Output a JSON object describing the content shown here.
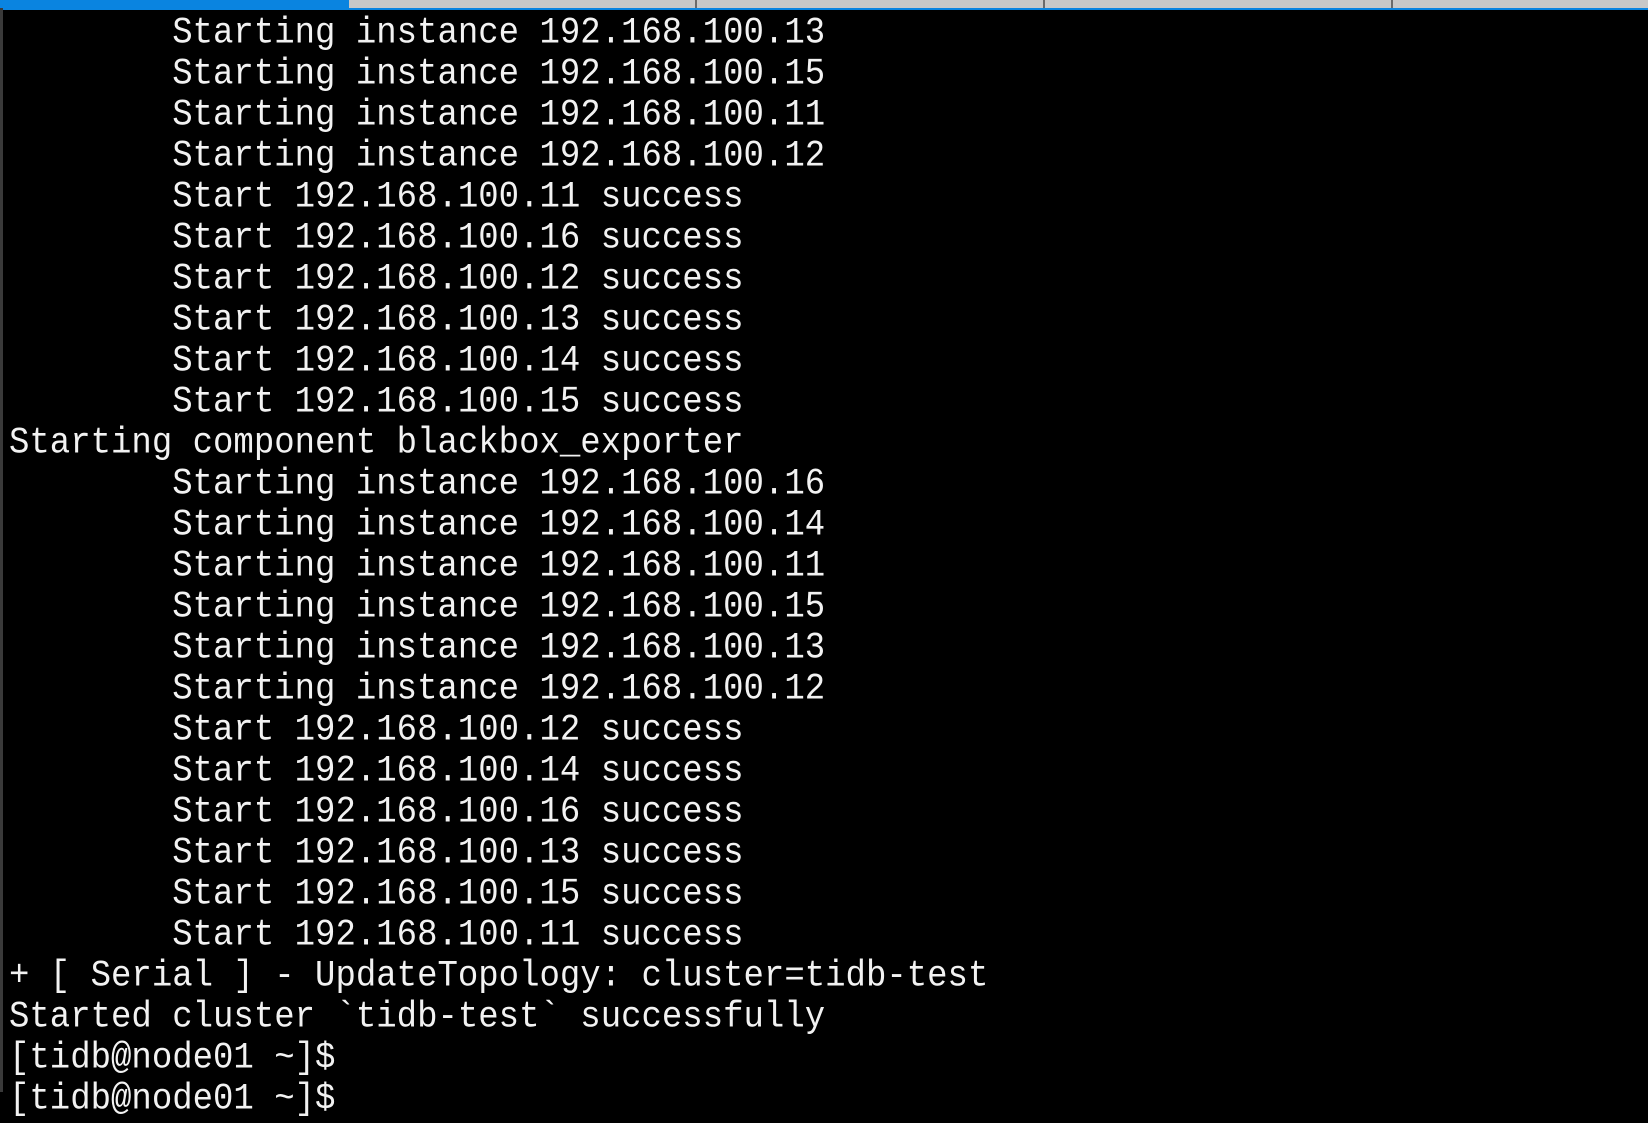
{
  "tabs": [
    {
      "active": true
    },
    {
      "active": false
    },
    {
      "active": false
    },
    {
      "active": false
    },
    {
      "active": false
    }
  ],
  "colors": {
    "background": "#000000",
    "text": "#f2f2f2",
    "active_tab": "#0a84e0",
    "inactive_tab": "#c8c8c8"
  },
  "terminal": {
    "lines": [
      "        Starting instance 192.168.100.13",
      "        Starting instance 192.168.100.15",
      "        Starting instance 192.168.100.11",
      "        Starting instance 192.168.100.12",
      "        Start 192.168.100.11 success",
      "        Start 192.168.100.16 success",
      "        Start 192.168.100.12 success",
      "        Start 192.168.100.13 success",
      "        Start 192.168.100.14 success",
      "        Start 192.168.100.15 success",
      "Starting component blackbox_exporter",
      "        Starting instance 192.168.100.16",
      "        Starting instance 192.168.100.14",
      "        Starting instance 192.168.100.11",
      "        Starting instance 192.168.100.15",
      "        Starting instance 192.168.100.13",
      "        Starting instance 192.168.100.12",
      "        Start 192.168.100.12 success",
      "        Start 192.168.100.14 success",
      "        Start 192.168.100.16 success",
      "        Start 192.168.100.13 success",
      "        Start 192.168.100.15 success",
      "        Start 192.168.100.11 success",
      "+ [ Serial ] - UpdateTopology: cluster=tidb-test",
      "Started cluster `tidb-test` successfully",
      "[tidb@node01 ~]$",
      "[tidb@node01 ~]$"
    ]
  }
}
